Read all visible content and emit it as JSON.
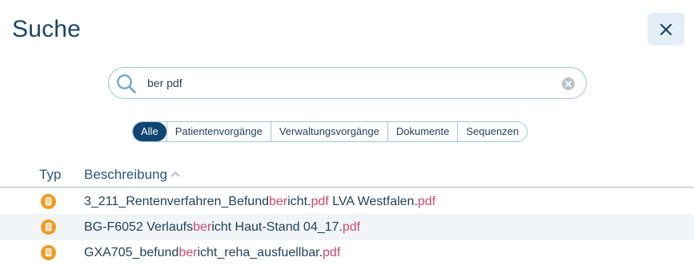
{
  "dialog": {
    "title": "Suche",
    "close_icon": "close-icon"
  },
  "search": {
    "value": "ber pdf",
    "search_icon": "search-icon",
    "clear_icon": "clear-circle-icon"
  },
  "filters": [
    {
      "label": "Alle",
      "active": true
    },
    {
      "label": "Patientenvorgänge",
      "active": false
    },
    {
      "label": "Verwaltungsvorgänge",
      "active": false
    },
    {
      "label": "Dokumente",
      "active": false
    },
    {
      "label": "Sequenzen",
      "active": false
    }
  ],
  "table": {
    "columns": {
      "type": "Typ",
      "description": "Beschreibung",
      "sort_icon": "chevron-up-icon"
    },
    "rows": [
      {
        "icon": "document-icon",
        "segments": [
          {
            "t": "3_211_Rentenverfahren_Befund"
          },
          {
            "t": "ber",
            "hl": true
          },
          {
            "t": "icht."
          },
          {
            "t": "pdf",
            "hl": true
          },
          {
            "t": " LVA Westfalen."
          },
          {
            "t": "pdf",
            "hl": true
          }
        ]
      },
      {
        "icon": "document-icon",
        "segments": [
          {
            "t": "BG-F6052 Verlaufs"
          },
          {
            "t": "ber",
            "hl": true
          },
          {
            "t": "icht Haut-Stand 04_17."
          },
          {
            "t": "pdf",
            "hl": true
          }
        ]
      },
      {
        "icon": "document-icon",
        "segments": [
          {
            "t": "GXA705_befund"
          },
          {
            "t": "ber",
            "hl": true
          },
          {
            "t": "icht_reha_ausfuellbar."
          },
          {
            "t": "pdf",
            "hl": true
          }
        ]
      }
    ]
  },
  "colors": {
    "title": "#1c4668",
    "accent": "#0f4570",
    "highlight": "#d0486e",
    "doc_icon": "#f39a1e",
    "border": "#9fc4dc",
    "row_alt": "#f1f5f8"
  }
}
